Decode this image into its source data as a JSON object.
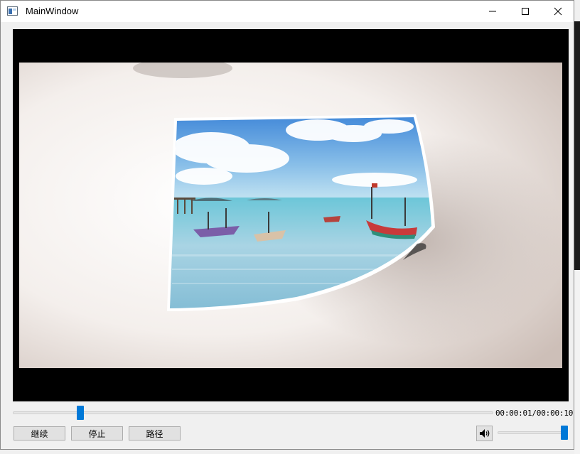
{
  "window": {
    "title": "MainWindow"
  },
  "player": {
    "progress_fraction": 0.1,
    "time_display": "00:00:01/00:00:10",
    "volume_fraction": 1.0
  },
  "controls": {
    "continue_label": "继续",
    "stop_label": "停止",
    "path_label": "路径"
  },
  "icons": {
    "app": "app-window-icon",
    "minimize": "minimize-icon",
    "maximize": "maximize-icon",
    "close": "close-icon",
    "volume": "speaker-icon"
  },
  "colors": {
    "accent": "#0078d7",
    "video_background": "#000000"
  }
}
